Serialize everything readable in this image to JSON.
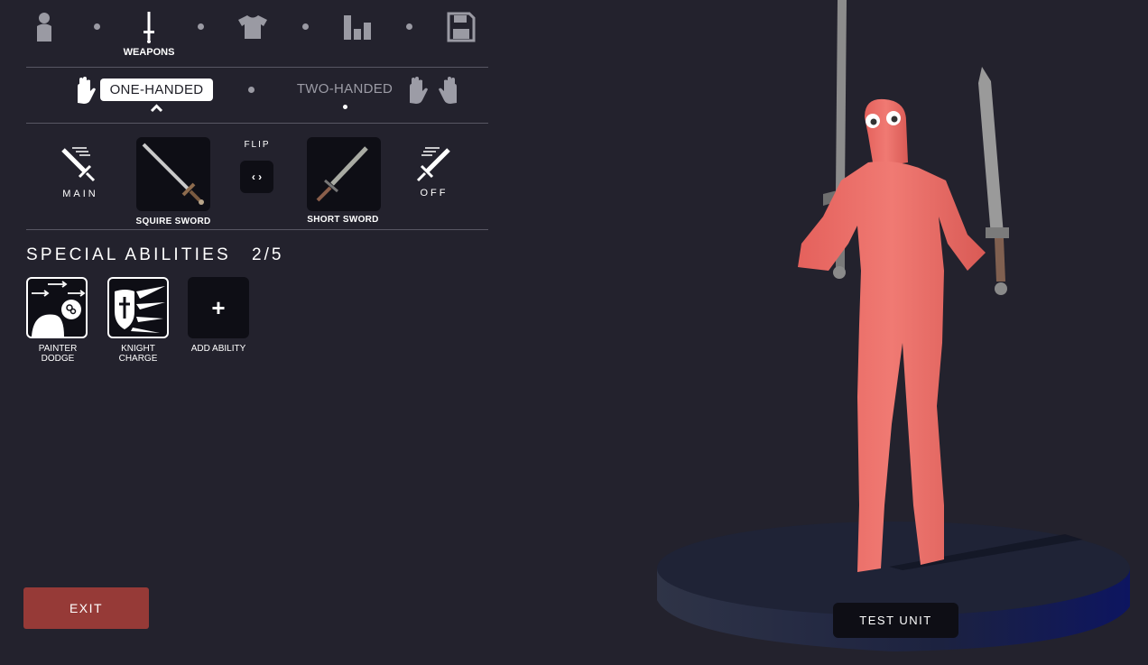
{
  "top_tabs": {
    "items": [
      {
        "icon": "person-icon"
      },
      {
        "icon": "sword-icon",
        "label": "WEAPONS",
        "active": true
      },
      {
        "icon": "shirt-icon"
      },
      {
        "icon": "stats-icon"
      },
      {
        "icon": "save-icon"
      }
    ],
    "active_label": "WEAPONS"
  },
  "handed": {
    "one_handed": "ONE-HANDED",
    "two_handed": "TWO-HANDED",
    "selected": "ONE-HANDED"
  },
  "weapons": {
    "main_label": "MAIN",
    "off_label": "OFF",
    "flip_label": "FLIP",
    "flip_symbol": "‹ ›",
    "main_weapon": "SQUIRE SWORD",
    "off_weapon": "SHORT SWORD"
  },
  "abilities": {
    "title": "SPECIAL ABILITIES",
    "count": "2/5",
    "items": [
      {
        "line1": "PAINTER",
        "line2": "DODGE"
      },
      {
        "line1": "KNIGHT",
        "line2": "CHARGE"
      },
      {
        "line1": "ADD ABILITY",
        "line2": ""
      }
    ],
    "add_symbol": "+"
  },
  "buttons": {
    "exit": "EXIT",
    "test_unit": "TEST UNIT"
  },
  "colors": {
    "background": "#23222d",
    "exit_button": "#963a37",
    "unit_body": "#e8706a",
    "platform": "#1d2236"
  }
}
